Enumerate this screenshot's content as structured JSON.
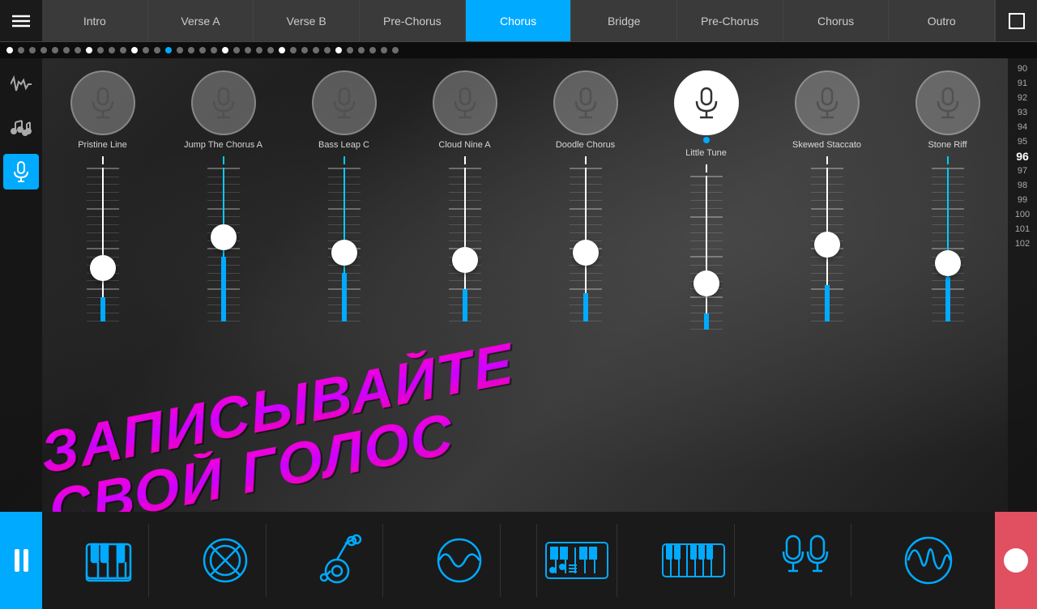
{
  "nav": {
    "tabs": [
      {
        "label": "Intro",
        "active": false
      },
      {
        "label": "Verse A",
        "active": false
      },
      {
        "label": "Verse B",
        "active": false
      },
      {
        "label": "Pre-Chorus",
        "active": false
      },
      {
        "label": "Chorus",
        "active": true
      },
      {
        "label": "Bridge",
        "active": false
      },
      {
        "label": "Pre-Chorus",
        "active": false
      },
      {
        "label": "Chorus",
        "active": false
      },
      {
        "label": "Outro",
        "active": false
      }
    ]
  },
  "scale": {
    "numbers": [
      "90",
      "91",
      "92",
      "93",
      "94",
      "95",
      "96",
      "97",
      "98",
      "99",
      "100",
      "101",
      "102"
    ],
    "highlight": "96"
  },
  "channels": [
    {
      "label": "Pristine Line",
      "active": false,
      "thumbPos": 65,
      "fillHeight": 30,
      "lineColor": "white"
    },
    {
      "label": "Jump The Chorus A",
      "active": false,
      "thumbPos": 45,
      "fillHeight": 80,
      "lineColor": "cyan"
    },
    {
      "label": "Bass Leap C",
      "active": false,
      "thumbPos": 55,
      "fillHeight": 60,
      "lineColor": "cyan"
    },
    {
      "label": "Cloud Nine  A",
      "active": false,
      "thumbPos": 60,
      "fillHeight": 40,
      "lineColor": "white"
    },
    {
      "label": "Doodle Chorus",
      "active": false,
      "thumbPos": 55,
      "fillHeight": 35,
      "lineColor": "white"
    },
    {
      "label": "Little Tune",
      "active": true,
      "thumbPos": 70,
      "fillHeight": 20,
      "lineColor": "white"
    },
    {
      "label": "Skewed Staccato",
      "active": false,
      "thumbPos": 50,
      "fillHeight": 45,
      "lineColor": "white"
    },
    {
      "label": "Stone Riff",
      "active": false,
      "thumbPos": 62,
      "fillHeight": 55,
      "lineColor": "cyan"
    }
  ],
  "overlay": {
    "line1": "ЗАПИСЫВАЙТЕ",
    "line2": "СВОЙ ГОЛОС"
  },
  "bottom_icons": [
    {
      "name": "piano",
      "type": "piano"
    },
    {
      "name": "drum",
      "type": "drum"
    },
    {
      "name": "guitar",
      "type": "guitar"
    },
    {
      "name": "synth-wave",
      "type": "wave"
    },
    {
      "name": "keyboard-synth",
      "type": "keyboard"
    },
    {
      "name": "keyboard2",
      "type": "keyboard2"
    },
    {
      "name": "mic-duo",
      "type": "mic-duo"
    },
    {
      "name": "waveform",
      "type": "waveform"
    }
  ]
}
